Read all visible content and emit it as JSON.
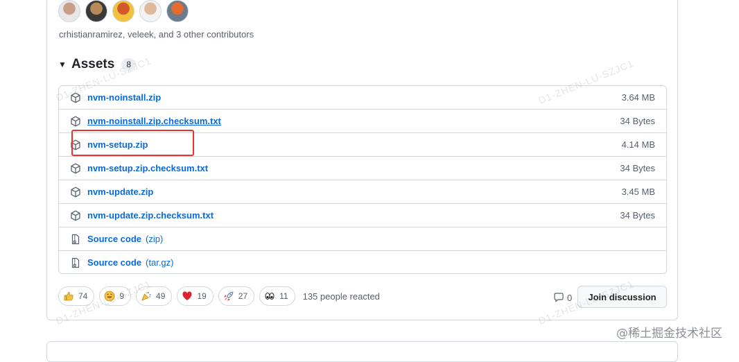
{
  "contributors": {
    "avatars": [
      {
        "colors": [
          "#e8e8e8",
          "#c99f8a"
        ]
      },
      {
        "colors": [
          "#3a3a3a",
          "#b88a5a"
        ]
      },
      {
        "colors": [
          "#f1c23b",
          "#d25a2a"
        ]
      },
      {
        "colors": [
          "#f2f2f2",
          "#e0b99a"
        ]
      },
      {
        "colors": [
          "#6a7c8c",
          "#e56b2f"
        ]
      }
    ],
    "text": "crhistianramirez, veleek, and 3 other contributors"
  },
  "assets": {
    "title": "Assets",
    "count": "8",
    "rows": [
      {
        "name": "nvm-noinstall.zip",
        "size": "3.64 MB",
        "icon": "package-icon"
      },
      {
        "name": "nvm-noinstall.zip.checksum.txt",
        "size": "34 Bytes",
        "icon": "package-icon"
      },
      {
        "name": "nvm-setup.zip",
        "size": "4.14 MB",
        "icon": "package-icon"
      },
      {
        "name": "nvm-setup.zip.checksum.txt",
        "size": "34 Bytes",
        "icon": "package-icon"
      },
      {
        "name": "nvm-update.zip",
        "size": "3.45 MB",
        "icon": "package-icon"
      },
      {
        "name": "nvm-update.zip.checksum.txt",
        "size": "34 Bytes",
        "icon": "package-icon"
      },
      {
        "name": "Source code",
        "paren": "(zip)",
        "size": "",
        "icon": "file-zip-icon"
      },
      {
        "name": "Source code",
        "paren": "(tar.gz)",
        "size": "",
        "icon": "file-zip-icon"
      }
    ]
  },
  "reactions": {
    "items": [
      {
        "emoji": "thumbs-up",
        "count": "74"
      },
      {
        "emoji": "laugh",
        "count": "9"
      },
      {
        "emoji": "hooray",
        "count": "49"
      },
      {
        "emoji": "heart",
        "count": "19"
      },
      {
        "emoji": "rocket",
        "count": "27"
      },
      {
        "emoji": "eyes",
        "count": "11"
      }
    ],
    "summary": "135 people reacted"
  },
  "discussion": {
    "comment_count": "0",
    "join_label": "Join discussion"
  },
  "watermarks": {
    "diagonal": "D1-ZHEN-LU-SZJC1",
    "site": "@稀土掘金技术社区"
  },
  "colors": {
    "link": "#0969da",
    "highlight": "#e8322d"
  }
}
